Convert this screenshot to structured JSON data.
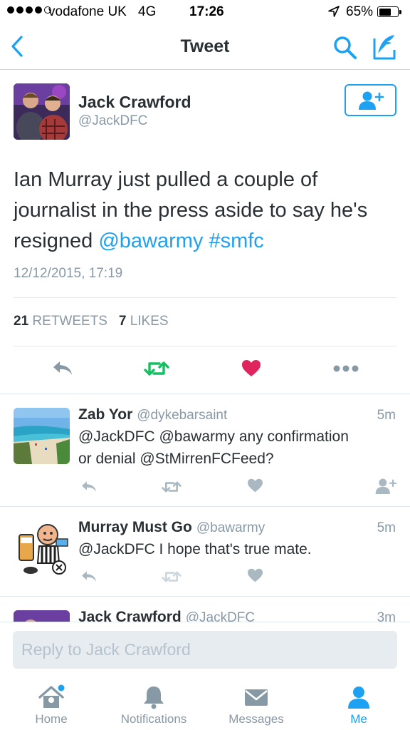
{
  "status_bar": {
    "carrier": "vodafone UK",
    "network": "4G",
    "time": "17:26",
    "battery": "65%",
    "battery_level": 0.65
  },
  "nav": {
    "title": "Tweet",
    "icons": [
      "back-chevron-icon",
      "search-icon",
      "compose-icon"
    ]
  },
  "tweet": {
    "name": "Jack Crawford",
    "handle": "@JackDFC",
    "text_line1": "Ian Murray just pulled a couple of",
    "text_line2": "journalist in the press aside to say he's",
    "text_line3": "resigned",
    "mention": "@bawarmy",
    "hashtag": "#smfc",
    "timestamp": "12/12/2015, 17:19",
    "retweets_count": "21",
    "retweets_label": "RETWEETS",
    "likes_count": "7",
    "likes_label": "LIKES",
    "liked": true
  },
  "replies": [
    {
      "name": "Zab Yor",
      "handle": "@dykebarsaint",
      "time": "5m",
      "text_line1": "@JackDFC @bawarmy any confirmation",
      "text_line2": "or denial @StMirrenFCFeed?"
    },
    {
      "name": "Murray Must Go",
      "handle": "@bawarmy",
      "time": "5m",
      "text_line1": "@JackDFC I hope that's true mate."
    },
    {
      "name": "Jack Crawford",
      "handle": "@JackDFC",
      "time": "3m"
    }
  ],
  "reply_bar": {
    "placeholder": "Reply to Jack Crawford"
  },
  "tabs": [
    {
      "label": "Home",
      "icon": "home-icon",
      "active": false
    },
    {
      "label": "Notifications",
      "icon": "bell-icon",
      "active": false
    },
    {
      "label": "Messages",
      "icon": "envelope-icon",
      "active": false
    },
    {
      "label": "Me",
      "icon": "person-icon",
      "active": true
    }
  ],
  "colors": {
    "accent": "#1da1f2",
    "retweet_green": "#17bf63",
    "like_red": "#e0245e",
    "muted": "#8899a6",
    "icon_gray": "#aab8c2"
  }
}
